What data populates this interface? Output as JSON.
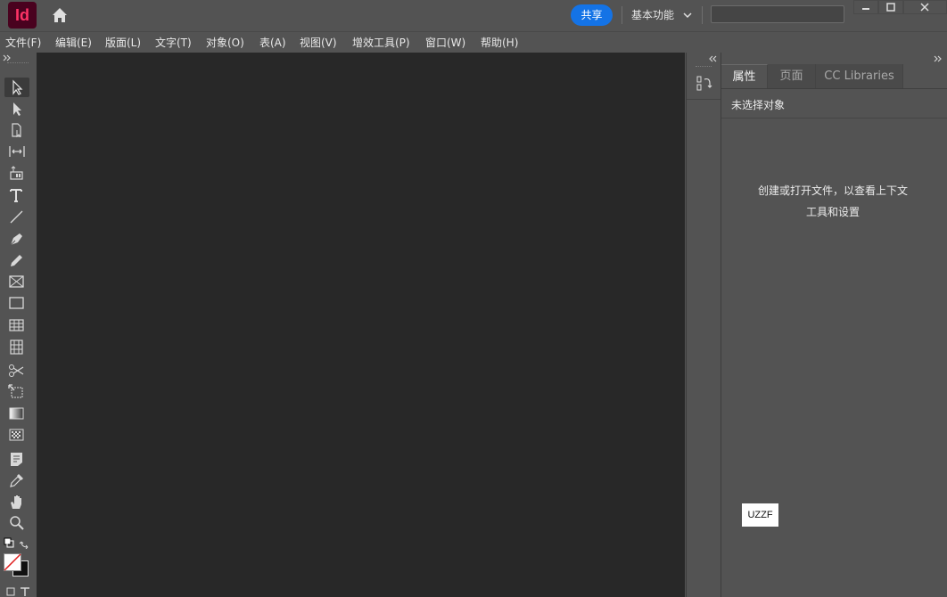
{
  "app": {
    "logo_text": "Id",
    "logo_bg": "#49021f",
    "logo_color": "#ff3366"
  },
  "titlebar": {
    "share_label": "共享",
    "workspace_label": "基本功能",
    "search_value": "",
    "home_icon": "home-icon",
    "window_controls": [
      "minimize-icon",
      "restore-icon",
      "close-icon"
    ]
  },
  "menu": [
    "文件(F)",
    "编辑(E)",
    "版面(L)",
    "文字(T)",
    "对象(O)",
    "表(A)",
    "视图(V)",
    "增效工具(P)",
    "窗口(W)",
    "帮助(H)"
  ],
  "tools": [
    "selection-tool-icon",
    "direct-selection-tool-icon",
    "page-tool-icon",
    "gap-tool-icon",
    "content-collector-icon",
    "type-tool-icon",
    "line-tool-icon",
    "pen-tool-icon",
    "pencil-tool-icon",
    "rectangle-frame-tool-icon",
    "rectangle-tool-icon",
    "table-tool-icon",
    "column-grid-icon",
    "scissors-tool-icon",
    "free-transform-tool-icon",
    "gradient-swatch-icon",
    "gradient-feather-icon",
    "note-tool-icon",
    "eyedropper-tool-icon",
    "hand-tool-icon",
    "zoom-tool-icon"
  ],
  "panel": {
    "tabs": [
      "属性",
      "页面",
      "CC Libraries"
    ],
    "active_tab": "属性",
    "no_selection_text": "未选择对象",
    "message_line1": "创建或打开文件，以查看上下文",
    "message_line2": "工具和设置"
  },
  "watermark_text": "UZZF",
  "colors": {
    "accent": "#1473e6",
    "canvas": "#282828",
    "chrome": "#535353"
  }
}
